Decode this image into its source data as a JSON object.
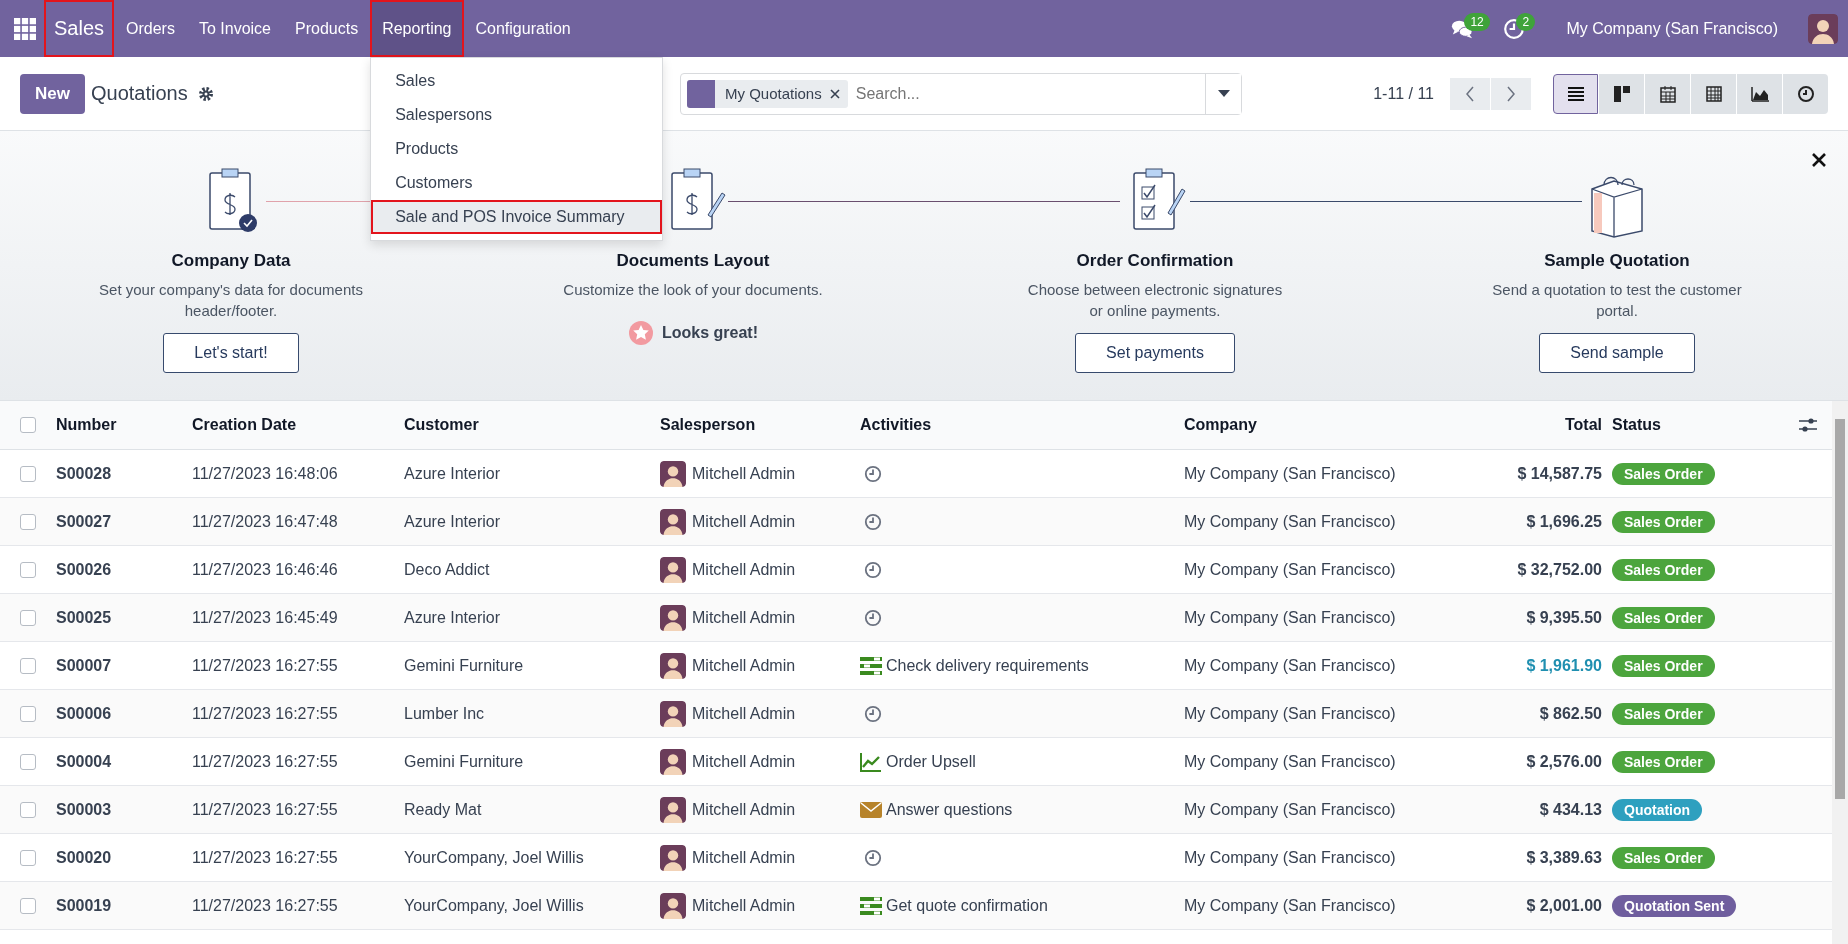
{
  "navbar": {
    "app_name": "Sales",
    "app_highlighted": true,
    "menu": [
      {
        "label": "Orders",
        "open": false,
        "highlighted": false
      },
      {
        "label": "To Invoice",
        "open": false,
        "highlighted": false
      },
      {
        "label": "Products",
        "open": false,
        "highlighted": false
      },
      {
        "label": "Reporting",
        "open": true,
        "highlighted": true
      },
      {
        "label": "Configuration",
        "open": false,
        "highlighted": false
      }
    ],
    "messages_count": "12",
    "activities_count": "2",
    "company": "My Company (San Francisco)"
  },
  "reporting_menu": {
    "items": [
      {
        "label": "Sales",
        "hovered": false,
        "highlighted": false
      },
      {
        "label": "Salespersons",
        "hovered": false,
        "highlighted": false
      },
      {
        "label": "Products",
        "hovered": false,
        "highlighted": false
      },
      {
        "label": "Customers",
        "hovered": false,
        "highlighted": false
      },
      {
        "label": "Sale and POS Invoice Summary",
        "hovered": true,
        "highlighted": true
      }
    ]
  },
  "control_panel": {
    "new_button": "New",
    "title": "Quotations",
    "search": {
      "facet": "My Quotations",
      "placeholder": "Search..."
    },
    "pager": "1-11 / 11",
    "views": [
      {
        "kind": "list",
        "selected": true
      },
      {
        "kind": "kanban",
        "selected": false
      },
      {
        "kind": "calendar",
        "selected": false
      },
      {
        "kind": "pivot",
        "selected": false
      },
      {
        "kind": "graph",
        "selected": false
      },
      {
        "kind": "activity",
        "selected": false
      }
    ]
  },
  "onboarding": {
    "steps": [
      {
        "kind": "clipboard",
        "title": "Company Data",
        "description_lines": [
          "Set your company's data for documents",
          "header/footer."
        ],
        "done": false,
        "action": "Let's start!"
      },
      {
        "kind": "layout",
        "title": "Documents Layout",
        "description_lines": [
          "Customize the look of your documents."
        ],
        "done": true,
        "action": "Looks great!"
      },
      {
        "kind": "checklist",
        "title": "Order Confirmation",
        "description_lines": [
          "Choose between electronic signatures",
          "or online payments."
        ],
        "done": false,
        "action": "Set payments"
      },
      {
        "kind": "box",
        "title": "Sample Quotation",
        "description_lines": [
          "Send a quotation to test the customer",
          "portal."
        ],
        "done": false,
        "action": "Send sample"
      }
    ]
  },
  "table": {
    "all_checked": false,
    "columns": [
      "Number",
      "Creation Date",
      "Customer",
      "Salesperson",
      "Activities",
      "Company",
      "Total",
      "Status"
    ],
    "rows": [
      {
        "checked": false,
        "number": "S00028",
        "creation_date": "11/27/2023 16:48:06",
        "customer": "Azure Interior",
        "salesperson": "Mitchell Admin",
        "activity": {
          "kind": "none"
        },
        "company": "My Company (San Francisco)",
        "total": "$ 14,587.75",
        "total_highlighted": false,
        "status": {
          "label": "Sales Order",
          "color": "#4ca53d"
        }
      },
      {
        "checked": false,
        "number": "S00027",
        "creation_date": "11/27/2023 16:47:48",
        "customer": "Azure Interior",
        "salesperson": "Mitchell Admin",
        "activity": {
          "kind": "none"
        },
        "company": "My Company (San Francisco)",
        "total": "$ 1,696.25",
        "total_highlighted": false,
        "status": {
          "label": "Sales Order",
          "color": "#4ca53d"
        }
      },
      {
        "checked": false,
        "number": "S00026",
        "creation_date": "11/27/2023 16:46:46",
        "customer": "Deco Addict",
        "salesperson": "Mitchell Admin",
        "activity": {
          "kind": "none"
        },
        "company": "My Company (San Francisco)",
        "total": "$ 32,752.00",
        "total_highlighted": false,
        "status": {
          "label": "Sales Order",
          "color": "#4ca53d"
        }
      },
      {
        "checked": false,
        "number": "S00025",
        "creation_date": "11/27/2023 16:45:49",
        "customer": "Azure Interior",
        "salesperson": "Mitchell Admin",
        "activity": {
          "kind": "none"
        },
        "company": "My Company (San Francisco)",
        "total": "$ 9,395.50",
        "total_highlighted": false,
        "status": {
          "label": "Sales Order",
          "color": "#4ca53d"
        }
      },
      {
        "checked": false,
        "number": "S00007",
        "creation_date": "11/27/2023 16:27:55",
        "customer": "Gemini Furniture",
        "salesperson": "Mitchell Admin",
        "activity": {
          "kind": "todo",
          "summary": "Check delivery requirements"
        },
        "company": "My Company (San Francisco)",
        "total": "$ 1,961.90",
        "total_highlighted": true,
        "status": {
          "label": "Sales Order",
          "color": "#4ca53d"
        }
      },
      {
        "checked": false,
        "number": "S00006",
        "creation_date": "11/27/2023 16:27:55",
        "customer": "Lumber Inc",
        "salesperson": "Mitchell Admin",
        "activity": {
          "kind": "none"
        },
        "company": "My Company (San Francisco)",
        "total": "$ 862.50",
        "total_highlighted": false,
        "status": {
          "label": "Sales Order",
          "color": "#4ca53d"
        }
      },
      {
        "checked": false,
        "number": "S00004",
        "creation_date": "11/27/2023 16:27:55",
        "customer": "Gemini Furniture",
        "salesperson": "Mitchell Admin",
        "activity": {
          "kind": "upsell",
          "summary": "Order Upsell"
        },
        "company": "My Company (San Francisco)",
        "total": "$ 2,576.00",
        "total_highlighted": false,
        "status": {
          "label": "Sales Order",
          "color": "#4ca53d"
        }
      },
      {
        "checked": false,
        "number": "S00003",
        "creation_date": "11/27/2023 16:27:55",
        "customer": "Ready Mat",
        "salesperson": "Mitchell Admin",
        "activity": {
          "kind": "email",
          "summary": "Answer questions"
        },
        "company": "My Company (San Francisco)",
        "total": "$ 434.13",
        "total_highlighted": false,
        "status": {
          "label": "Quotation",
          "color": "#2ea0bf"
        }
      },
      {
        "checked": false,
        "number": "S00020",
        "creation_date": "11/27/2023 16:27:55",
        "customer": "YourCompany, Joel Willis",
        "salesperson": "Mitchell Admin",
        "activity": {
          "kind": "none"
        },
        "company": "My Company (San Francisco)",
        "total": "$ 3,389.63",
        "total_highlighted": false,
        "status": {
          "label": "Sales Order",
          "color": "#4ca53d"
        }
      },
      {
        "checked": false,
        "number": "S00019",
        "creation_date": "11/27/2023 16:27:55",
        "customer": "YourCompany, Joel Willis",
        "salesperson": "Mitchell Admin",
        "activity": {
          "kind": "todo",
          "summary": "Get quote confirmation"
        },
        "company": "My Company (San Francisco)",
        "total": "$ 2,001.00",
        "total_highlighted": false,
        "status": {
          "label": "Quotation Sent",
          "color": "#6f5e9e"
        }
      }
    ]
  }
}
